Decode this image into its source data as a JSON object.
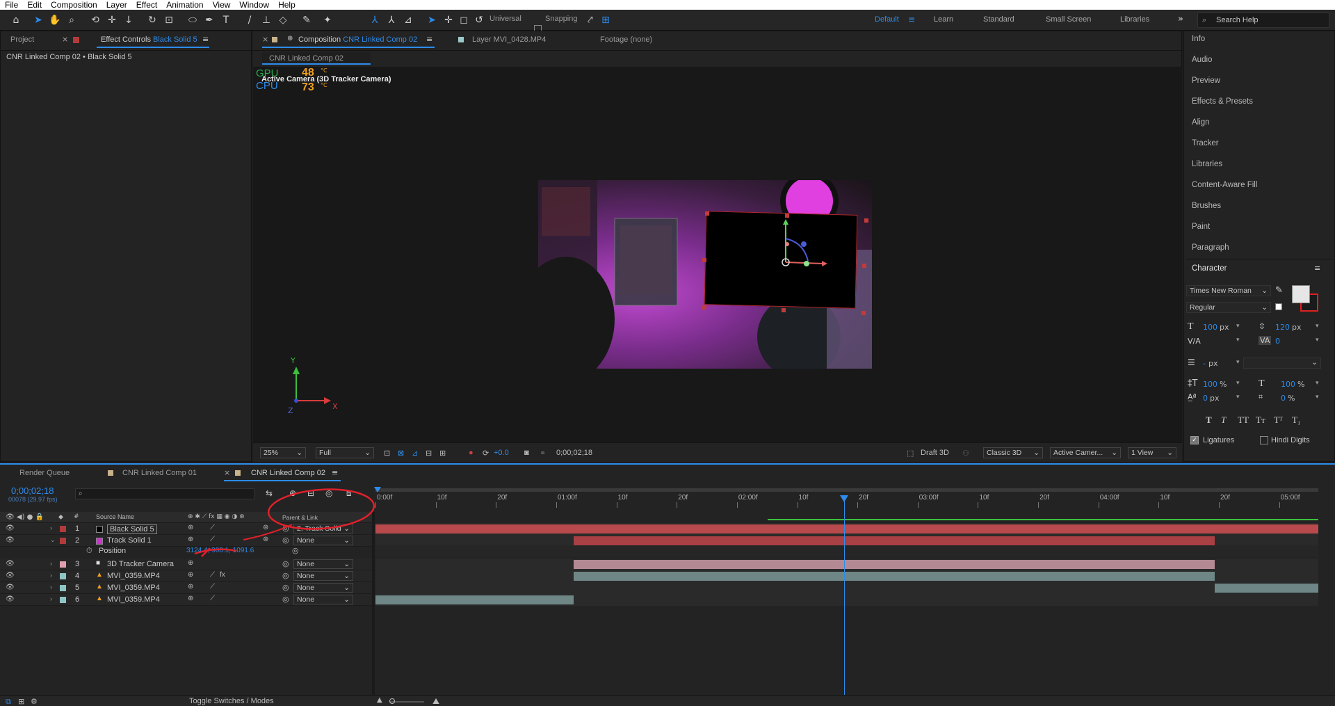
{
  "menu": [
    "File",
    "Edit",
    "Composition",
    "Layer",
    "Effect",
    "Animation",
    "View",
    "Window",
    "Help"
  ],
  "toolbar": {
    "universal_label": "Universal",
    "snapping_label": "Snapping",
    "workspaces": [
      "Default",
      "Learn",
      "Standard",
      "Small Screen",
      "Libraries"
    ],
    "active_workspace": "Default",
    "search_placeholder": "Search Help"
  },
  "left_panel": {
    "tab_project": "Project",
    "tab_effect_controls": "Effect Controls",
    "effect_controls_layer": "Black Solid 5",
    "breadcrumb": "CNR  Linked Comp 02 • Black Solid 5"
  },
  "comp_panel": {
    "tab_composition": "Composition",
    "comp_name": "CNR  Linked Comp 02",
    "tab_layer": "Layer  MVI_0428.MP4",
    "tab_footage": "Footage  (none)",
    "active_comp_chip": "CNR  Linked Comp 02",
    "camera_label": "Active Camera (3D Tracker Camera)",
    "gpu_label": "GPU",
    "gpu_temp": "48",
    "cpu_label": "CPU",
    "cpu_temp": "73",
    "temp_unit": "°C",
    "axis_y": "Y",
    "axis_x": "X",
    "axis_z": "Z",
    "zoom": "25%",
    "resolution": "Full",
    "exposure": "+0.0",
    "timecode": "0;00;02;18",
    "renderer_mode": "Draft 3D",
    "renderer": "Classic 3D",
    "view": "Active Camer...",
    "view_layout": "1 View"
  },
  "right_panel": {
    "items": [
      "Info",
      "Audio",
      "Preview",
      "Effects & Presets",
      "Align",
      "Tracker",
      "Libraries",
      "Content-Aware Fill",
      "Brushes",
      "Paint",
      "Paragraph"
    ],
    "character_title": "Character",
    "font_family": "Times New Roman",
    "font_style": "Regular",
    "font_size": "100",
    "font_size_unit": "px",
    "leading": "120",
    "leading_unit": "px",
    "tracking": "0",
    "stroke_width": "-",
    "stroke_unit": "px",
    "vert_scale": "100",
    "horiz_scale": "100",
    "percent": "%",
    "baseline_shift": "0",
    "baseline_unit": "px",
    "tsume": "0",
    "tsume_unit": "%",
    "ligatures_label": "Ligatures",
    "hindi_digits_label": "Hindi Digits",
    "fill_color": "#e6e6e6",
    "stroke_color": "#1a1a1a"
  },
  "timeline": {
    "tabs": [
      "Render Queue",
      "CNR  Linked Comp 01",
      "CNR  Linked Comp 02"
    ],
    "current_time": "0;00;02;18",
    "frame_info": "00078 (29.97 fps)",
    "col_source_name": "Source Name",
    "col_parent": "Parent & Link",
    "ruler_labels": [
      "0:00f",
      "10f",
      "20f",
      "01:00f",
      "10f",
      "20f",
      "02:00f",
      "10f",
      "20f",
      "03:00f",
      "10f",
      "20f",
      "04:00f",
      "10f",
      "20f",
      "05:00f"
    ],
    "layers": [
      {
        "num": "1",
        "name": "Black Solid 5",
        "color": "#b33a3a",
        "swatch": "#000000",
        "parent": "2. Track Solid",
        "bar_color": "#b84a4d",
        "bar_start": 0.0,
        "bar_end": 1.0
      },
      {
        "num": "2",
        "name": "Track Solid 1",
        "color": "#b33a3a",
        "swatch": "#cc33cc",
        "parent": "None",
        "bar_color": "#a94044",
        "bar_start": 0.21,
        "bar_end": 0.89
      },
      {
        "num": "3",
        "name": "3D Tracker Camera",
        "color": "#e0a0b0",
        "swatch": "",
        "parent": "None",
        "bar_color": "#b38a94",
        "bar_start": 0.21,
        "bar_end": 0.89
      },
      {
        "num": "4",
        "name": "MVI_0359.MP4",
        "color": "#8fc4c4",
        "swatch": "",
        "parent": "None",
        "bar_color": "#6e8686",
        "bar_start": 0.21,
        "bar_end": 0.89
      },
      {
        "num": "5",
        "name": "MVI_0359.MP4",
        "color": "#8fc4c4",
        "swatch": "",
        "parent": "None",
        "bar_color": "#6e8686",
        "bar_start": 0.89,
        "bar_end": 1.0
      },
      {
        "num": "6",
        "name": "MVI_0359.MP4",
        "color": "#8fc4c4",
        "swatch": "",
        "parent": "None",
        "bar_color": "#6e8686",
        "bar_start": 0.0,
        "bar_end": 0.21
      }
    ],
    "position_label": "Position",
    "position_value": "3124.4, 908.1, 1091.6",
    "playhead": 0.5,
    "toggle_label": "Toggle Switches / Modes"
  }
}
